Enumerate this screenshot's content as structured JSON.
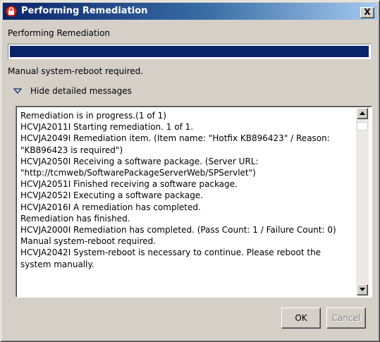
{
  "window": {
    "title": "Performing Remediation",
    "close_label": "X",
    "app_icon": "lock-icon"
  },
  "header_label": "Performing Remediation",
  "progress": {
    "value": 1.0,
    "color": "#0a246a"
  },
  "status_text": "Manual system-reboot required.",
  "details_toggle": {
    "label": "Hide detailed messages",
    "icon": "triangle-down-icon"
  },
  "log_lines": [
    "Remediation is in progress.(1 of 1)",
    "HCVJA2011I Starting remediation. 1 of 1.",
    "HCVJA2049I Remediation item. (Item name: \"Hotfix KB896423\" / Reason: \"KB896423 is required\")",
    "HCVJA2050I Receiving a software package. (Server URL: \"http://tcmweb/SoftwarePackageServerWeb/SPServlet\")",
    "HCVJA2051I Finished receiving a software package.",
    "HCVJA2052I Executing a software package.",
    "HCVJA2016I A remediation has completed.",
    "Remediation has finished.",
    "HCVJA2000I Remediation has completed. (Pass Count: 1 / Failure Count: 0)",
    "Manual system-reboot required.",
    "HCVJA2042I System-reboot is necessary to continue. Please reboot the system manually."
  ],
  "buttons": {
    "ok": "OK",
    "cancel": "Cancel"
  }
}
